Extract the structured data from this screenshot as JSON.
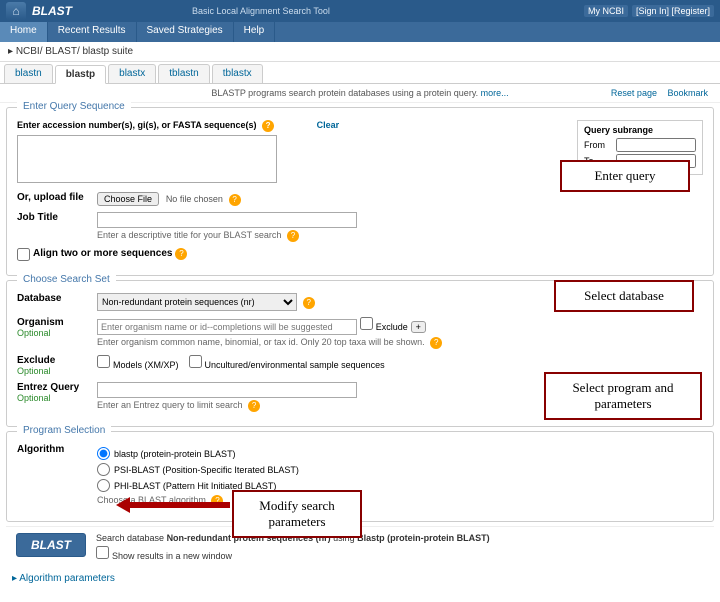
{
  "header": {
    "app": "BLAST",
    "subtitle": "Basic Local Alignment Search Tool",
    "right": [
      "My NCBI",
      "[Sign In] [Register]"
    ]
  },
  "nav": {
    "items": [
      "Home",
      "Recent Results",
      "Saved Strategies",
      "Help"
    ],
    "right": ""
  },
  "breadcrumb": "NCBI/ BLAST/ blastp suite",
  "tabs": [
    "blastn",
    "blastp",
    "blastx",
    "tblastn",
    "tblastx"
  ],
  "info": {
    "text_prefix": "BLASTP programs search protein databases using a protein query. ",
    "more": "more...",
    "reset": "Reset page",
    "bookmark": "Bookmark"
  },
  "query": {
    "section_title": "Enter Query Sequence",
    "accession_label": "Enter accession number(s), gi(s), or FASTA sequence(s)",
    "clear": "Clear",
    "subrange_title": "Query subrange",
    "from": "From",
    "to": "To",
    "upload_lbl": "Or, upload file",
    "choose_file": "Choose File",
    "no_file": "No file chosen",
    "jobtitle_lbl": "Job Title",
    "jobtitle_hint": "Enter a descriptive title for your BLAST search",
    "align2": "Align two or more sequences"
  },
  "searchset": {
    "section_title": "Choose Search Set",
    "db_lbl": "Database",
    "db_value": "Non-redundant protein sequences (nr)",
    "org_lbl": "Organism",
    "optional": "Optional",
    "org_placeholder": "Enter organism name or id--completions will be suggested",
    "exclude": "Exclude",
    "plus": "+",
    "org_hint": "Enter organism common name, binomial, or tax id. Only 20 top taxa will be shown.",
    "excl_lbl": "Exclude",
    "excl1": "Models (XM/XP)",
    "excl2": "Uncultured/environmental sample sequences",
    "eq_lbl": "Entrez Query",
    "eq_hint": "Enter an Entrez query to limit search"
  },
  "program": {
    "section_title": "Program Selection",
    "algo_lbl": "Algorithm",
    "r1": "blastp (protein-protein BLAST)",
    "r2": "PSI-BLAST (Position-Specific Iterated BLAST)",
    "r3": "PHI-BLAST (Pattern Hit Initiated BLAST)",
    "choose_hint": "Choose a BLAST algorithm"
  },
  "run": {
    "btn": "BLAST",
    "desc_prefix": "Search database ",
    "desc_db": "Non-redundant protein sequences (nr)",
    "desc_mid": " using ",
    "desc_algo": "Blastp (protein-protein BLAST)",
    "newwin": "Show results in a new window"
  },
  "algo_params": "Algorithm parameters",
  "annotations": {
    "a1": "Enter query",
    "a2": "Select database",
    "a3": "Select program and parameters",
    "a4": "Modify search parameters"
  }
}
